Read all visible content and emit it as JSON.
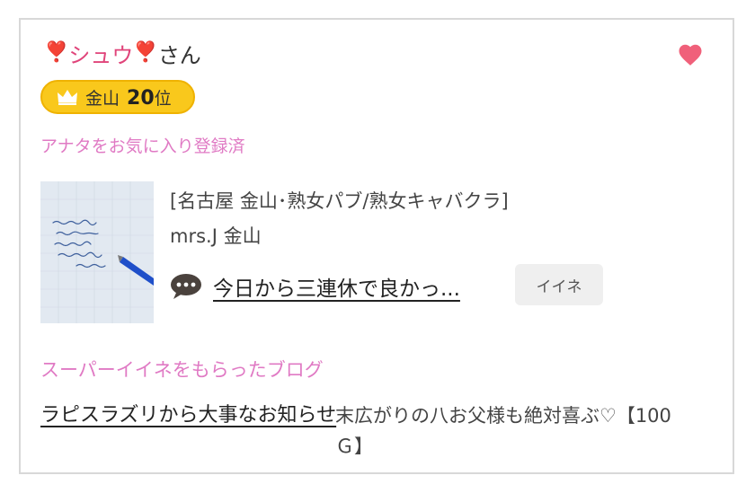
{
  "profile": {
    "name": "シュウ",
    "suffix": "さん",
    "heart_emoji": "❣️"
  },
  "rank": {
    "area": "金山",
    "number": "20",
    "unit": "位"
  },
  "favorite_status": "アナタをお気に入り登録済",
  "shop": {
    "category": "[名古屋 金山･熟女パブ/熟女キャバクラ]",
    "name": "mrs.J 金山"
  },
  "post": {
    "title": "今日から三連休で良かっ...",
    "iine_label": "イイネ"
  },
  "super_iine": {
    "heading": "スーパーイイネをもらったブログ",
    "blog_title": "ラピスラズリから大事なお知らせ",
    "blog_detail": "末広がりの八お父様も絶対喜ぶ♡【100Ｇ】"
  },
  "colors": {
    "accent_pink": "#e07ac4",
    "heart": "#f0607a",
    "badge": "#f9c81c"
  },
  "icons": {
    "favorite": "heart-icon",
    "rank": "crown-icon",
    "post": "speech-bubble-icon"
  }
}
